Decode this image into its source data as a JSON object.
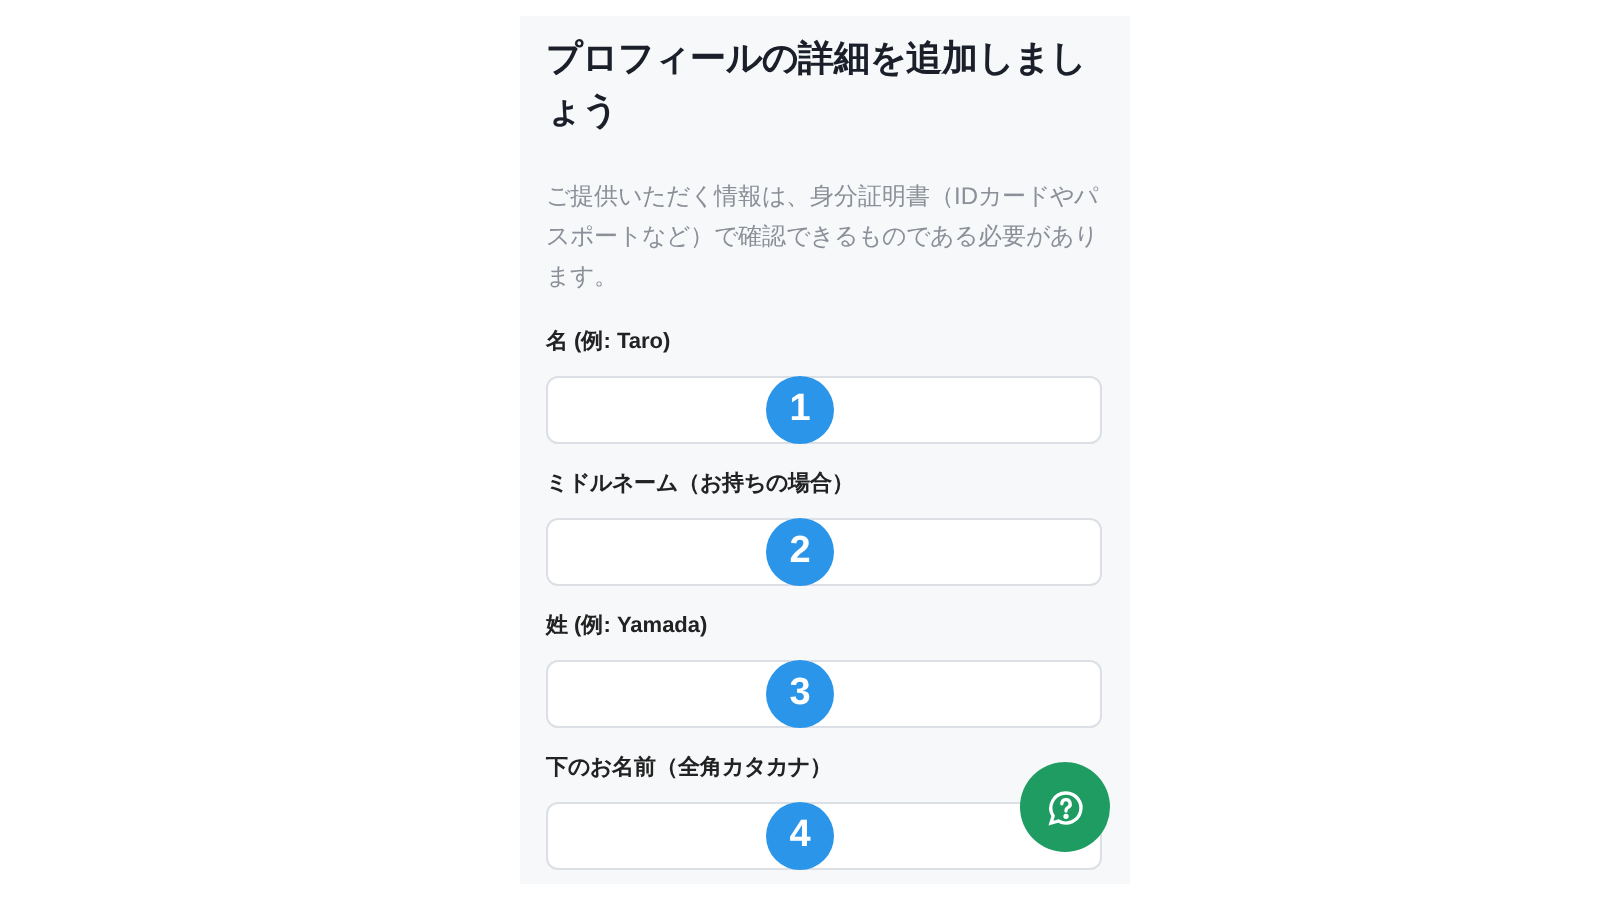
{
  "title": "プロフィールの詳細を追加しましょう",
  "description": "ご提供いただく情報は、身分証明書（IDカードやパスポートなど）で確認できるものである必要があります。",
  "fields": [
    {
      "label": "名 (例: Taro)",
      "badge": "1"
    },
    {
      "label": "ミドルネーム（お持ちの場合）",
      "badge": "2"
    },
    {
      "label": "姓 (例: Yamada)",
      "badge": "3"
    },
    {
      "label": "下のお名前（全角カタカナ）",
      "badge": "4"
    }
  ]
}
